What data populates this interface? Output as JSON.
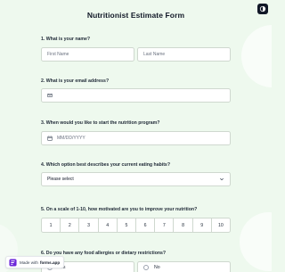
{
  "form": {
    "title": "Nutritionist Estimate Form"
  },
  "questions": {
    "q1": {
      "label": "1.  What is your name?",
      "first_name_placeholder": "First Name",
      "last_name_placeholder": "Last Name"
    },
    "q2": {
      "label": "2.  What is your email address?"
    },
    "q3": {
      "label": "3.  When would you like to start the nutrition program?",
      "date_placeholder": "MM/DD/YYYY"
    },
    "q4": {
      "label": "4.  Which option best describes your current eating habits?",
      "select_value": "Please select"
    },
    "q5": {
      "label": "5.  On a scale of 1-10, how motivated are you to improve your nutrition?",
      "options": [
        "1",
        "2",
        "3",
        "4",
        "5",
        "6",
        "7",
        "8",
        "9",
        "10"
      ]
    },
    "q6": {
      "label": "6.  Do you have any food allergies or dietary restrictions?",
      "option_yes_partial": "Yes",
      "option_no": "No"
    }
  },
  "badge": {
    "prefix": "Made with",
    "brand": "forms.app"
  },
  "icons": {
    "theme": "contrast-icon",
    "email": "envelope-icon",
    "date": "calendar-icon",
    "select": "chevron-down-icon",
    "badge": "forms-app-logo-icon"
  },
  "colors": {
    "background": "#eef9ee",
    "field_border": "#cfd8cf",
    "text": "#1f2937",
    "accent_logo": "#6d28d9"
  }
}
